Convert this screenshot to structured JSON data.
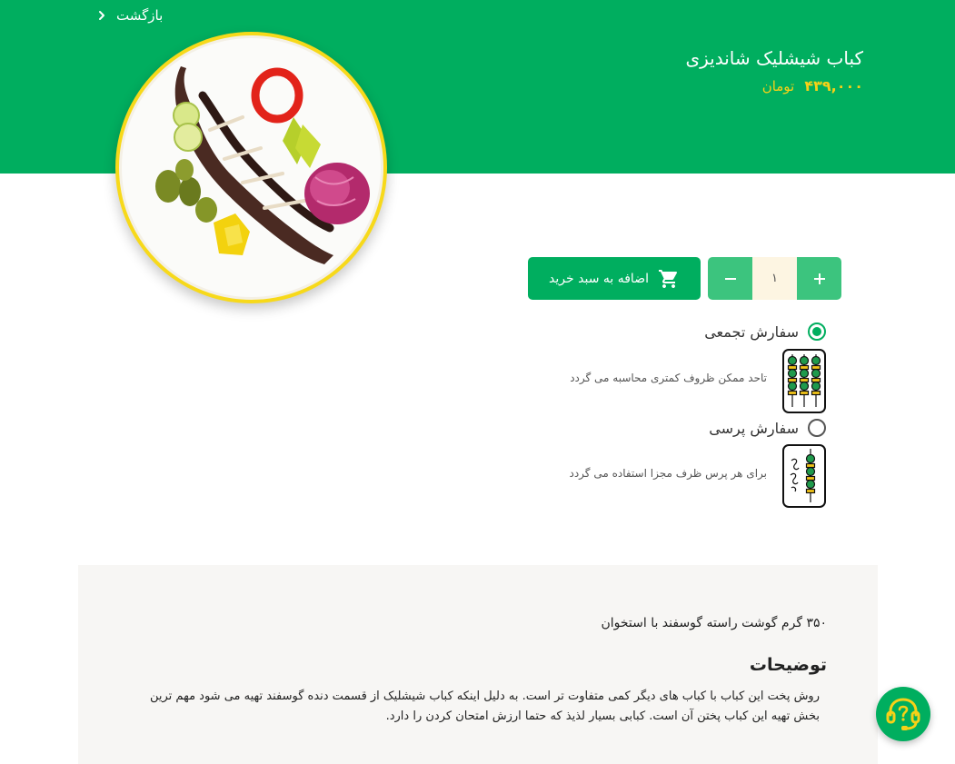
{
  "header": {
    "back_label": "بازگشت",
    "back_icon": "chevron-right-icon"
  },
  "product": {
    "title": "کباب شیشلیک شاندیزی",
    "price": "۴۳۹,۰۰۰",
    "currency": "تومان"
  },
  "cart": {
    "add_label": "اضافه به سبد خرید",
    "icon": "cart-icon",
    "quantity": "۱"
  },
  "order_options": [
    {
      "label": "سفارش تجمعی",
      "selected": true,
      "description": "تاحد ممکن ظروف کمتری محاسبه می گردد",
      "icon": "grouped-skewers-icon"
    },
    {
      "label": "سفارش پرسی",
      "selected": false,
      "description": "برای هر پرس ظرف مجزا استفاده می گردد",
      "icon": "single-skewer-icon"
    }
  ],
  "details": {
    "weight": "۳۵۰ گرم گوشت راسته گوسفند با استخوان",
    "description_title": "توضیحات",
    "description": "روش پخت این کباب با کباب های دیگر کمی متفاوت تر است. به دلیل اینکه کباب شیشلیک از قسمت دنده گوسفند تهیه می شود مهم ترین بخش تهیه این کباب پختن آن است. کبابی بسیار لذیذ که حتما ارزش امتحان کردن را دارد."
  },
  "support": {
    "icon": "support-headset-icon"
  },
  "colors": {
    "brand_green": "#00ae5f",
    "stepper_green": "#3cc47e",
    "price_yellow": "#f7d117",
    "panel_bg": "#f7f6f4"
  }
}
